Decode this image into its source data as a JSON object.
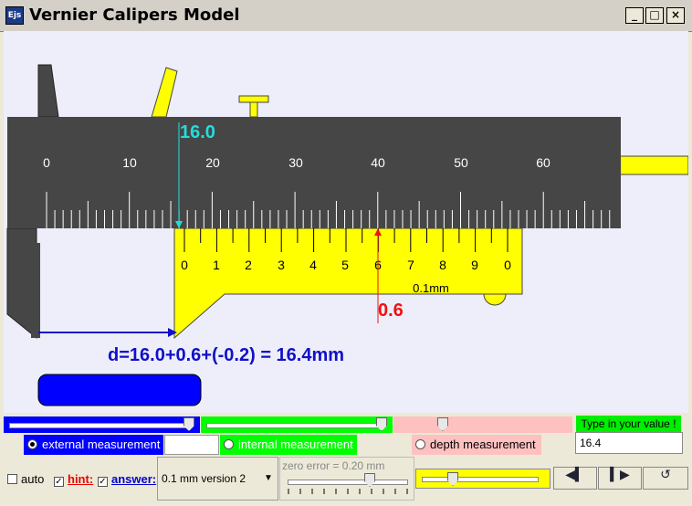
{
  "window": {
    "icon_label": "Ejs",
    "title": "Vernier Calipers Model",
    "minimize": "_",
    "maximize": "□",
    "close": "×"
  },
  "caliper": {
    "main_scale_labels": [
      "0",
      "10",
      "20",
      "30",
      "40",
      "50",
      "60"
    ],
    "vernier_labels": [
      "0",
      "1",
      "2",
      "3",
      "4",
      "5",
      "6",
      "7",
      "8",
      "9",
      "0"
    ],
    "vernier_unit": "0.1mm",
    "main_reading": "16.0",
    "vernier_reading": "0.6",
    "formula": "d=16.0+0.6+(-0.2) = 16.4mm"
  },
  "colors": {
    "main_scale": "#464646",
    "jaw_yellow": "#ffff00",
    "main_marker": "#22dddd",
    "vernier_marker": "#ee1111",
    "object": "#0000ff",
    "formula": "#1010c8"
  },
  "controls": {
    "slider_external": 0.96,
    "slider_internal": 0.96,
    "slider_depth": 0.28,
    "slider_zero_error": 0.6,
    "slider_speed": 0.3,
    "input_prompt": "Type in your value !",
    "input_value": "16.4",
    "radio_external": "external measurement",
    "radio_internal": "internal measurement",
    "radio_depth": "depth measurement",
    "auto_label": "auto",
    "hint_label": "hint:",
    "answer_label": "answer:",
    "version_selected": "0.1 mm version 2",
    "zero_error_label": "zero error = 0.20 mm",
    "check_mark": "✓",
    "dropdown_arrow": "▼",
    "btn_step_back": "◀▍",
    "btn_step_forward": "▍▶",
    "btn_reset": "↺"
  }
}
